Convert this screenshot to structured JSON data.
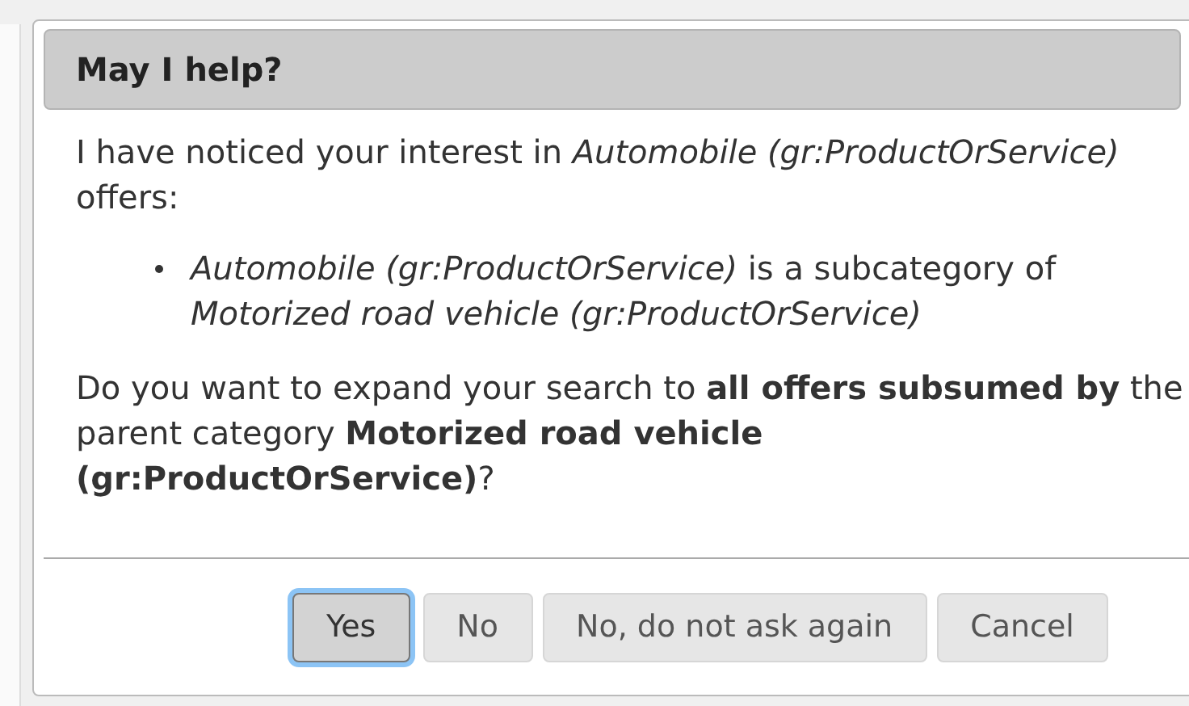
{
  "dialog": {
    "title": "May I help?",
    "intro": "I have noticed your interest in *Automobile (gr:ProductOrService)* offers:",
    "bullets": [
      "*Automobile (gr:ProductOrService)* is a subcategory of *Motorized road vehicle (gr:ProductOrService)*"
    ],
    "question": "Do you want to expand your search to **all offers subsumed by** the parent category **Motorized road vehicle (gr:ProductOrService)**?",
    "buttons": [
      {
        "label": "Yes",
        "selected": true
      },
      {
        "label": "No",
        "selected": false
      },
      {
        "label": "No, do not ask again",
        "selected": false
      },
      {
        "label": "Cancel",
        "selected": false
      }
    ]
  }
}
